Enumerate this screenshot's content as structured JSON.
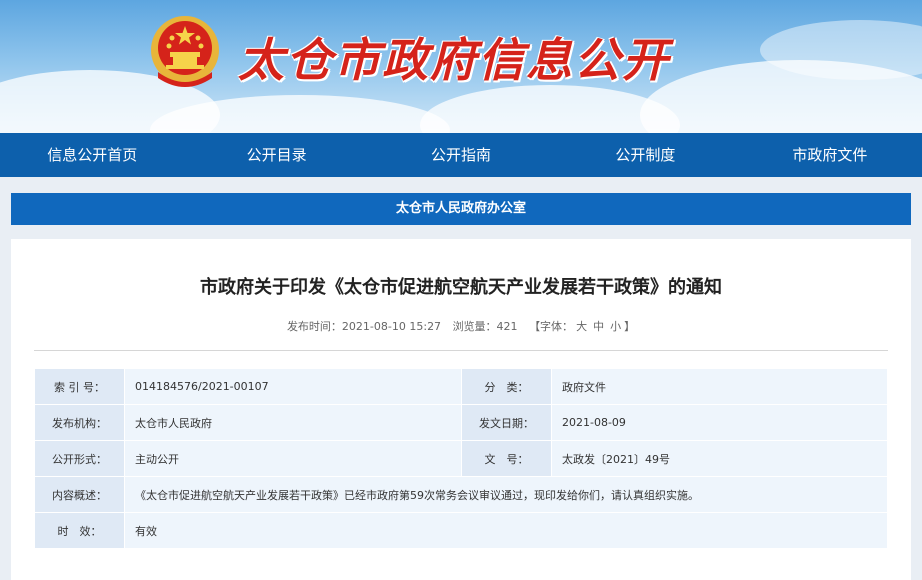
{
  "header": {
    "site_title": "太仓市政府信息公开",
    "emblem_icon": "national-emblem-icon",
    "title_color": "#d5231a"
  },
  "nav": {
    "items": [
      {
        "label": "信息公开首页"
      },
      {
        "label": "公开目录"
      },
      {
        "label": "公开指南"
      },
      {
        "label": "公开制度"
      },
      {
        "label": "市政府文件"
      }
    ],
    "color": "#0d60ac"
  },
  "department": "太仓市人民政府办公室",
  "article": {
    "title": "市政府关于印发《太仓市促进航空航天产业发展若干政策》的通知",
    "publish_time": "发布时间：2021-08-10 15:27",
    "views": "浏览量：421",
    "font_label": "【字体：",
    "font_large": "大",
    "font_medium": "中",
    "font_small": "小",
    "font_close": "】"
  },
  "info": {
    "index_label": "索 引 号：",
    "index_value": "014184576/2021-00107",
    "category_label": "分　类：",
    "category_value": "政府文件",
    "issuer_label": "发布机构：",
    "issuer_value": "太仓市人民政府",
    "issue_date_label": "发文日期：",
    "issue_date_value": "2021-08-09",
    "form_label": "公开形式：",
    "form_value": "主动公开",
    "docno_label": "文　号：",
    "docno_value": "太政发〔2021〕49号",
    "summary_label": "内容概述：",
    "summary_value": "《太仓市促进航空航天产业发展若干政策》已经市政府第59次常务会议审议通过，现印发给你们，请认真组织实施。",
    "validity_label": "时　效：",
    "validity_value": "有效"
  }
}
